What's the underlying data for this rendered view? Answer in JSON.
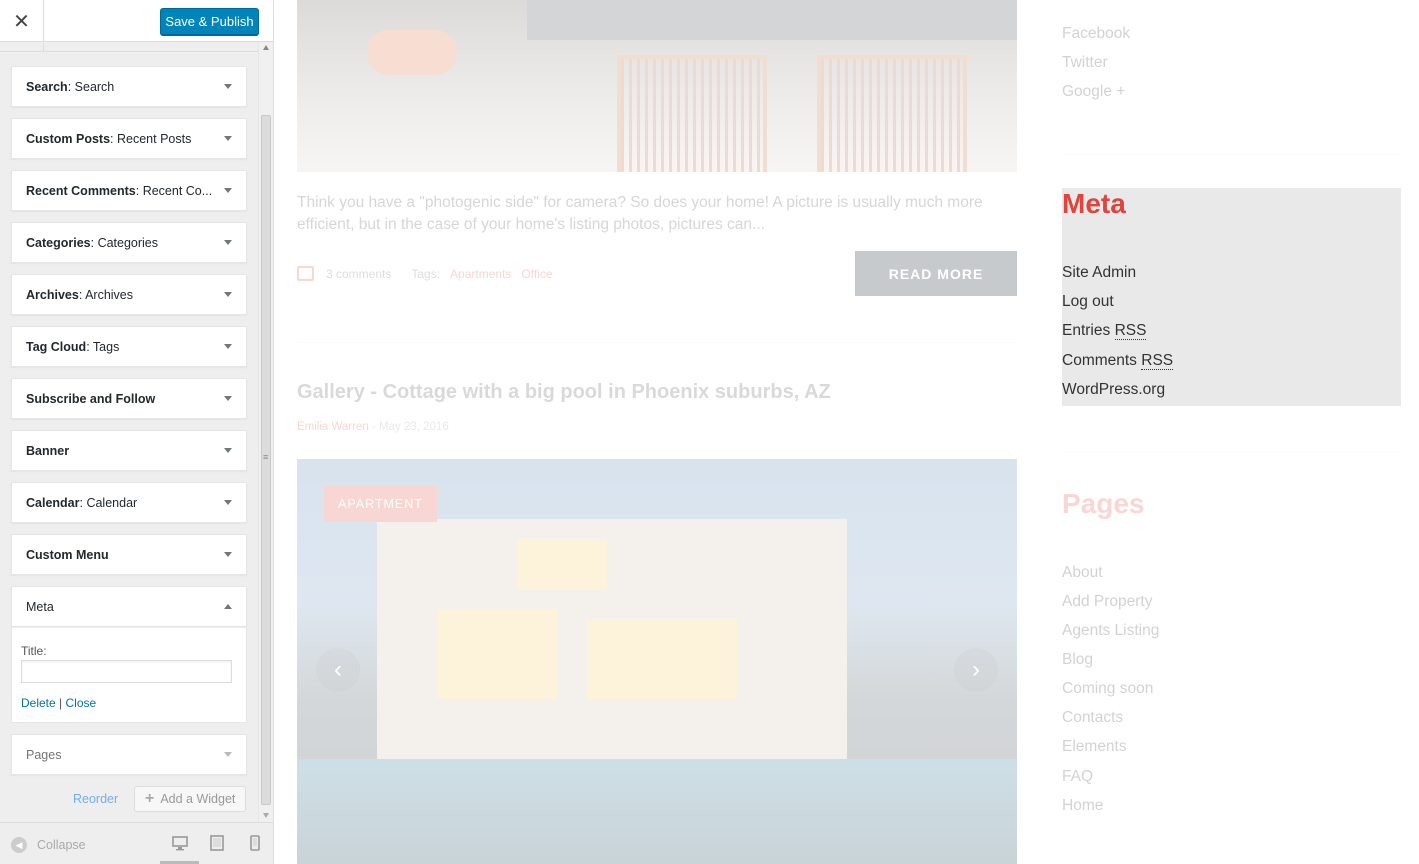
{
  "header": {
    "close_icon": "close-icon",
    "save_label": "Save & Publish",
    "accent": "#0085ba"
  },
  "widgets": [
    {
      "name": "Search",
      "title": "Search"
    },
    {
      "name": "Custom Posts",
      "title": "Recent Posts"
    },
    {
      "name": "Recent Comments",
      "title": "Recent Co..."
    },
    {
      "name": "Categories",
      "title": "Categories"
    },
    {
      "name": "Archives",
      "title": "Archives"
    },
    {
      "name": "Tag Cloud",
      "title": "Tags"
    },
    {
      "name": "Subscribe and Follow",
      "title": ""
    },
    {
      "name": "Banner",
      "title": ""
    },
    {
      "name": "Calendar",
      "title": "Calendar"
    },
    {
      "name": "Custom Menu",
      "title": ""
    },
    {
      "name": "Meta",
      "title": ""
    },
    {
      "name": "Pages",
      "title": ""
    }
  ],
  "meta_form": {
    "title_label": "Title:",
    "title_value": "",
    "delete_label": "Delete",
    "separator": "|",
    "close_label": "Close"
  },
  "sidebar_actions": {
    "reorder_label": "Reorder",
    "add_widget_label": "Add a Widget"
  },
  "footer": {
    "collapse_label": "Collapse",
    "devices": [
      "desktop-icon",
      "tablet-icon",
      "mobile-icon"
    ]
  },
  "preview": {
    "post1": {
      "excerpt": "Think you have a \"photogenic side\" for camera? So does your home! A picture is usually much more efficient, but in the case of your home's listing photos, pictures can...",
      "comments": "3 comments",
      "tags_label": "Tags:",
      "tags": [
        "Apartments",
        "Office"
      ],
      "read_more": "READ MORE"
    },
    "post2": {
      "title": "Gallery - Cottage with a big pool in Phoenix suburbs, AZ",
      "author": "Emilia Warren",
      "dash": "-",
      "date": "May 23, 2016",
      "badge": "APARTMENT"
    },
    "social_links": [
      "Facebook",
      "Twitter",
      "Google +"
    ],
    "meta_widget": {
      "heading": "Meta",
      "links": [
        "Site Admin",
        "Log out",
        "Entries",
        "Comments",
        "WordPress.org"
      ],
      "rss": "RSS"
    },
    "pages_widget": {
      "heading": "Pages",
      "links": [
        "About",
        "Add Property",
        "Agents Listing",
        "Blog",
        "Coming soon",
        "Contacts",
        "Elements",
        "FAQ",
        "Home"
      ]
    },
    "accent": "#e0443c"
  }
}
